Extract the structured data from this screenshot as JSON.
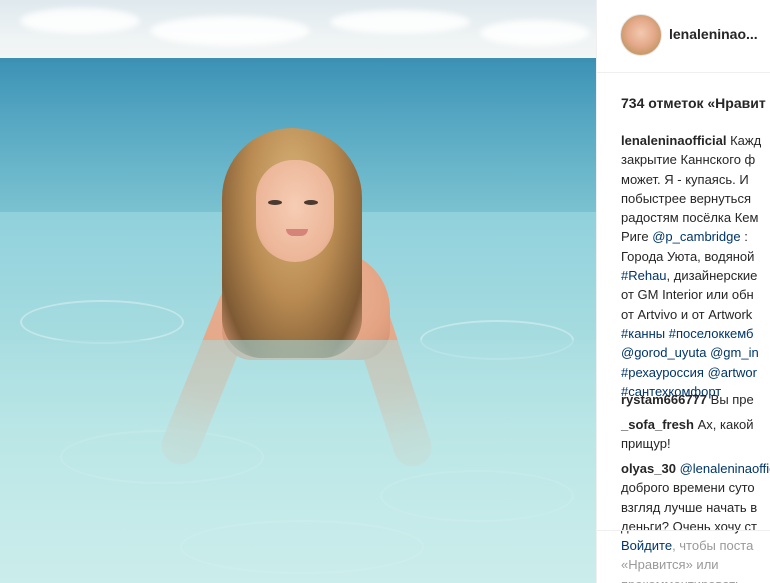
{
  "post": {
    "username": "lenaleninao...",
    "likes": "734 отметок «Нравит",
    "caption_lines": [
      "Кажд",
      "закрытие Каннского ф",
      "может. Я - купаясь. И",
      "побыстрее вернуться",
      "радостям посёлка Кем",
      "Риге ",
      "Города Уюта, водяной",
      ", дизайнерские",
      "от GM Interior или обн",
      "от Artvivo и от Artwork",
      "",
      "",
      "",
      ""
    ],
    "caption_user": "lenaleninaofficial",
    "caption_mention_1": "@p_cambridge",
    "caption_after_mention_1": " :",
    "caption_tag_rehau": "#Rehau",
    "caption_tags_line_10": "#канны #поселоккемб",
    "caption_tags_line_11": "@gorod_uyuta @gm_in",
    "caption_tags_line_12a": "#рехауроссия",
    "caption_tags_line_12b": " @artwor",
    "caption_tags_line_13": "#сантехкомфорт"
  },
  "comments": [
    {
      "user": "rystam666777",
      "lines": [
        " Вы пре"
      ]
    },
    {
      "user": "_sofa_fresh",
      "lines": [
        " Ах, какой",
        "прищур!"
      ]
    },
    {
      "user": "olyas_30",
      "mention": "@lenaleninaofficial",
      "lines": [
        " ",
        "доброго времени суто",
        "взгляд лучше начать в",
        "деньги? Очень хочу ст"
      ]
    }
  ],
  "login_prompt": {
    "link": "Войдите",
    "text_1": ", чтобы поста",
    "text_2": "«Нравится» или",
    "text_3": "прокомментировать"
  },
  "colors": {
    "link": "#003569",
    "text": "#262626",
    "muted": "#999999",
    "divider": "#efefef"
  }
}
